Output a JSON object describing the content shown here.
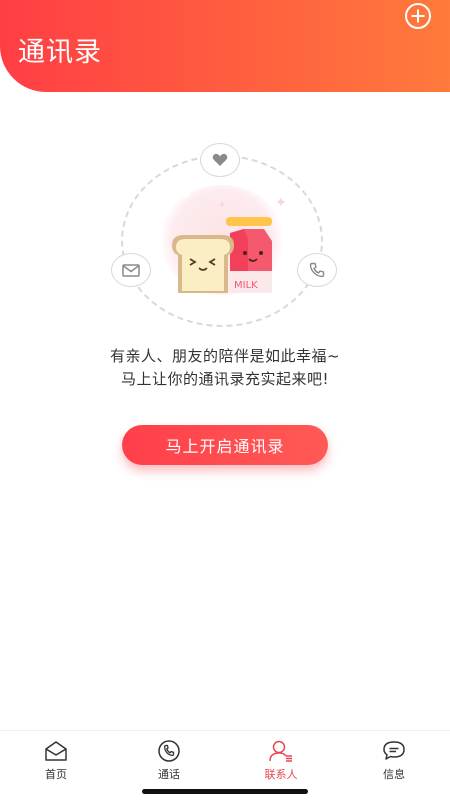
{
  "header": {
    "title": "通讯录",
    "add_icon": "plus-circle-icon"
  },
  "illustration": {
    "icons": [
      "heart-icon",
      "mail-icon",
      "phone-icon"
    ],
    "milk_text": "MILK"
  },
  "empty_state": {
    "line1": "有亲人、朋友的陪伴是如此幸福~",
    "line2": "马上让你的通讯录充实起来吧!",
    "button_label": "马上开启通讯录"
  },
  "tabbar": {
    "items": [
      {
        "label": "首页",
        "icon": "home-icon",
        "active": false
      },
      {
        "label": "通话",
        "icon": "phone-icon",
        "active": false
      },
      {
        "label": "联系人",
        "icon": "contacts-icon",
        "active": true
      },
      {
        "label": "信息",
        "icon": "message-icon",
        "active": false
      }
    ]
  },
  "colors": {
    "accent": "#ff4a4a",
    "active_tab": "#e8474f"
  }
}
